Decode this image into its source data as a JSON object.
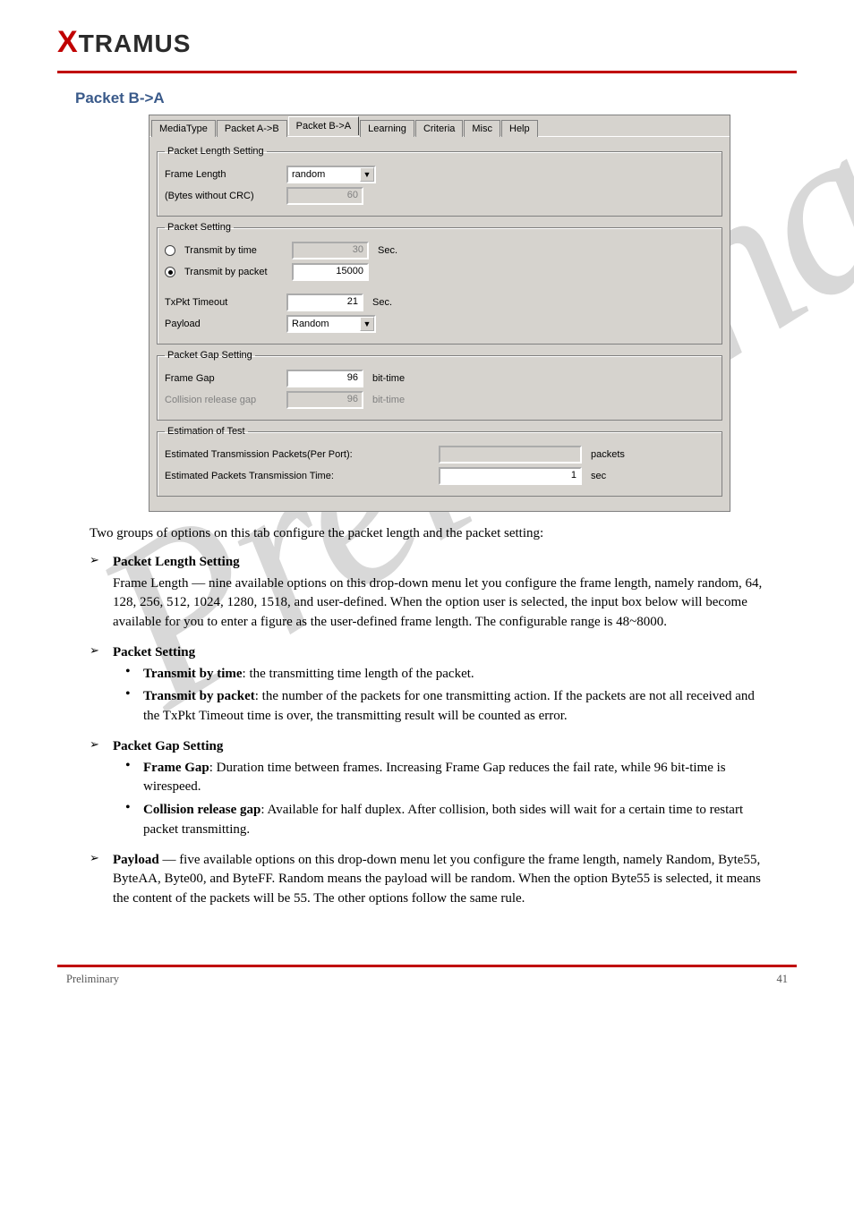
{
  "header": {
    "logo_text": "TRAMUS"
  },
  "section_title": "Packet B->A",
  "watermark": "Preliminary",
  "tabs": {
    "items": [
      "MediaType",
      "Packet A->B",
      "Packet B->A",
      "Learning",
      "Criteria",
      "Misc",
      "Help"
    ],
    "active_index": 2
  },
  "groups": {
    "pkt_len": {
      "legend": "Packet Length Setting",
      "frame_length_label": "Frame Length",
      "frame_length_value": "random",
      "bytes_label": "(Bytes without CRC)",
      "bytes_value": "60"
    },
    "pkt_set": {
      "legend": "Packet Setting",
      "tx_time_label": "Transmit by time",
      "tx_time_value": "30",
      "tx_time_suffix": "Sec.",
      "tx_pkt_label": "Transmit by packet",
      "tx_pkt_value": "15000",
      "txpkt_to_label": "TxPkt Timeout",
      "txpkt_to_value": "21",
      "txpkt_to_suffix": "Sec.",
      "payload_label": "Payload",
      "payload_value": "Random"
    },
    "pkt_gap": {
      "legend": "Packet Gap Setting",
      "frame_gap_label": "Frame Gap",
      "frame_gap_value": "96",
      "frame_gap_suffix": "bit-time",
      "coll_label": "Collision release gap",
      "coll_value": "96",
      "coll_suffix": "bit-time"
    },
    "estimation": {
      "legend": "Estimation of Test",
      "est_tx_label": "Estimated Transmission Packets(Per Port):",
      "est_tx_value": "",
      "est_tx_suffix": "packets",
      "est_time_label": "Estimated Packets Transmission Time:",
      "est_time_value": "1",
      "est_time_suffix": "sec"
    }
  },
  "text": {
    "lead": "Two groups of options on this tab configure the packet length and the packet setting:",
    "itemA_title": "Packet Length Setting",
    "itemA_body1": "Frame Length — nine available options on this drop-down menu let you configure the frame length, namely random, 64, 128, 256, 512, 1024, 1280, 1518, and user-defined. When the option user is selected, the input box below will become available for you to enter a figure as the user-defined frame length. The configurable range is 48~8000.",
    "itemB_title": "Packet Setting",
    "itemB_sub1_b": "Transmit by time",
    "itemB_sub1_t": ": the transmitting time length of the packet.",
    "itemB_sub2_b": "Transmit by packet",
    "itemB_sub2_t": ": the number of the packets for one transmitting action. If the packets are not all received and the TxPkt Timeout time is over, the transmitting result will be counted as error.",
    "itemC_title": "Packet Gap Setting",
    "itemC_sub1_b": "Frame Gap",
    "itemC_sub1_t": ": Duration time between frames. Increasing Frame Gap reduces the fail rate, while 96 bit-time is wirespeed.",
    "itemC_sub2_b": "Collision release gap",
    "itemC_sub2_t": ": Available for half duplex. After collision, both sides will wait for a certain time to restart packet transmitting.",
    "itemD_title": "Payload",
    "itemD_body": " — five available options on this drop-down menu let you configure the frame length, namely Random, Byte55, ByteAA, Byte00, and ByteFF. Random means the payload will be random. When the option Byte55 is selected, it means the content of the packets will be 55. The other options follow the same rule."
  },
  "footer": {
    "left": "Preliminary",
    "right": "41"
  }
}
